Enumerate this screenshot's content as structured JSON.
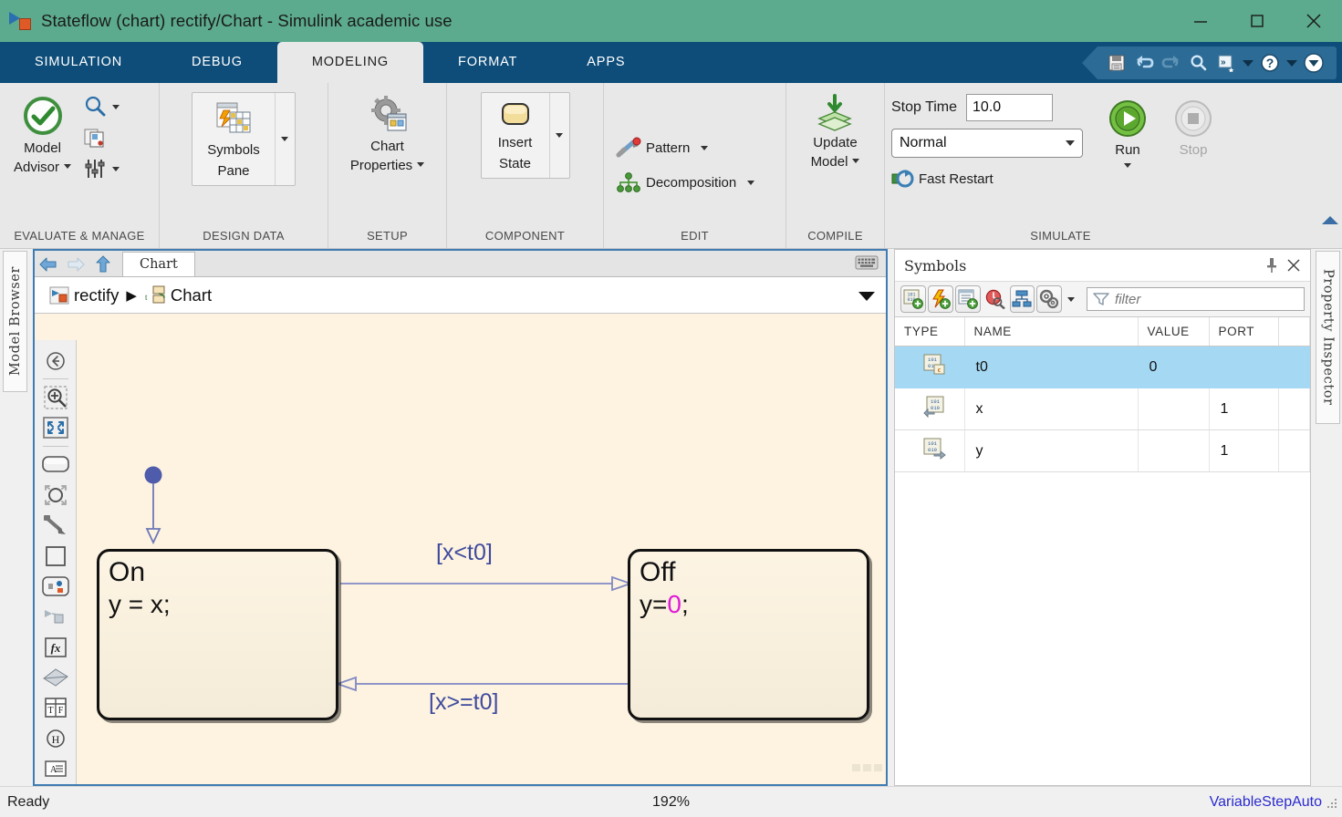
{
  "window": {
    "title": "Stateflow (chart) rectify/Chart - Simulink academic use",
    "icon": "stateflow-icon",
    "minimize": "minimize-button",
    "maximize": "maximize-button",
    "close": "close-button"
  },
  "ribbon": {
    "tabs": [
      {
        "label": "SIMULATION",
        "active": false
      },
      {
        "label": "DEBUG",
        "active": false
      },
      {
        "label": "MODELING",
        "active": true
      },
      {
        "label": "FORMAT",
        "active": false
      },
      {
        "label": "APPS",
        "active": false
      }
    ],
    "quick_access": [
      {
        "name": "save-icon"
      },
      {
        "name": "undo-icon"
      },
      {
        "name": "redo-icon"
      },
      {
        "name": "search-icon"
      },
      {
        "name": "shortcuts-icon"
      },
      {
        "name": "help-icon"
      },
      {
        "name": "more-options-icon"
      }
    ],
    "groups": [
      {
        "label": "EVALUATE & MANAGE",
        "model_advisor": "Model\nAdvisor",
        "model_advisor_line1": "Model",
        "model_advisor_line2": "Advisor"
      },
      {
        "label": "DESIGN DATA",
        "symbols_pane_line1": "Symbols",
        "symbols_pane_line2": "Pane"
      },
      {
        "label": "SETUP",
        "chart_properties_line1": "Chart",
        "chart_properties_line2": "Properties"
      },
      {
        "label": "COMPONENT",
        "insert_state_line1": "Insert",
        "insert_state_line2": "State"
      },
      {
        "label": "EDIT",
        "pattern": "Pattern",
        "decomposition": "Decomposition"
      },
      {
        "label": "COMPILE",
        "update_model_line1": "Update",
        "update_model_line2": "Model"
      },
      {
        "label": "SIMULATE",
        "stop_time_label": "Stop Time",
        "stop_time_value": "10.0",
        "sim_mode": "Normal",
        "fast_restart": "Fast Restart",
        "run": "Run",
        "stop": "Stop"
      }
    ]
  },
  "left_dock": {
    "label": "Model Browser"
  },
  "right_dock": {
    "label": "Property Inspector"
  },
  "editor": {
    "tab_label": "Chart",
    "back": "back-button",
    "forward": "forward-button",
    "up": "up-button",
    "keyboard_icon": "keyboard-icon",
    "breadcrumb": [
      {
        "label": "rectify",
        "icon": "model-icon"
      },
      {
        "label": "Chart",
        "icon": "chart-icon"
      }
    ],
    "breadcrumb_separator": "▶"
  },
  "palette": [
    {
      "name": "navigate-back-icon"
    },
    {
      "name": "zoom-in-icon"
    },
    {
      "name": "fit-to-view-icon"
    },
    {
      "name": "state-icon"
    },
    {
      "name": "junction-icon"
    },
    {
      "name": "transition-icon"
    },
    {
      "name": "box-icon"
    },
    {
      "name": "graphical-function-icon"
    },
    {
      "name": "simulink-function-icon"
    },
    {
      "name": "matlab-function-icon"
    },
    {
      "name": "truth-table-icon"
    },
    {
      "name": "message-icon"
    },
    {
      "name": "annotation-icon"
    }
  ],
  "chart": {
    "states": [
      {
        "name": "On",
        "action": "y = x;",
        "action_prefix": "y = x",
        "action_value": "",
        "action_suffix": ";"
      },
      {
        "name": "Off",
        "action_prefix": "y=",
        "action_value": "0",
        "action_suffix": ";"
      }
    ],
    "transitions": [
      {
        "label": "[x<t0]",
        "direction": "On-to-Off"
      },
      {
        "label": "[x>=t0]",
        "direction": "Off-to-On"
      }
    ],
    "default_transition": "default-transition",
    "matlab_badge": "matlab-logo-icon"
  },
  "symbols": {
    "title": "Symbols",
    "pin": "pin-button",
    "close": "close-button",
    "toolbar": [
      {
        "name": "add-data-icon"
      },
      {
        "name": "add-event-icon"
      },
      {
        "name": "add-message-icon"
      },
      {
        "name": "resolve-undefined-icon"
      },
      {
        "name": "show-hierarchy-icon"
      },
      {
        "name": "settings-icon"
      }
    ],
    "filter_placeholder": "filter",
    "columns": [
      "TYPE",
      "NAME",
      "VALUE",
      "PORT"
    ],
    "rows": [
      {
        "type_icon": "constant-data-icon",
        "name": "t0",
        "value": "0",
        "port": "",
        "selected": true
      },
      {
        "type_icon": "input-data-icon",
        "name": "x",
        "value": "",
        "port": "1",
        "selected": false
      },
      {
        "type_icon": "output-data-icon",
        "name": "y",
        "value": "",
        "port": "1",
        "selected": false
      }
    ]
  },
  "status": {
    "ready": "Ready",
    "zoom": "192%",
    "solver": "VariableStepAuto"
  },
  "colors": {
    "title_bar": "#5cab8e",
    "ribbon_tabs": "#0e4d79",
    "canvas": "#fdf3e0",
    "transition": "#3f4a9e",
    "selection": "#a5d8f3",
    "numeric_literal": "#e01bd6",
    "solver_link": "#2a2ad0"
  }
}
